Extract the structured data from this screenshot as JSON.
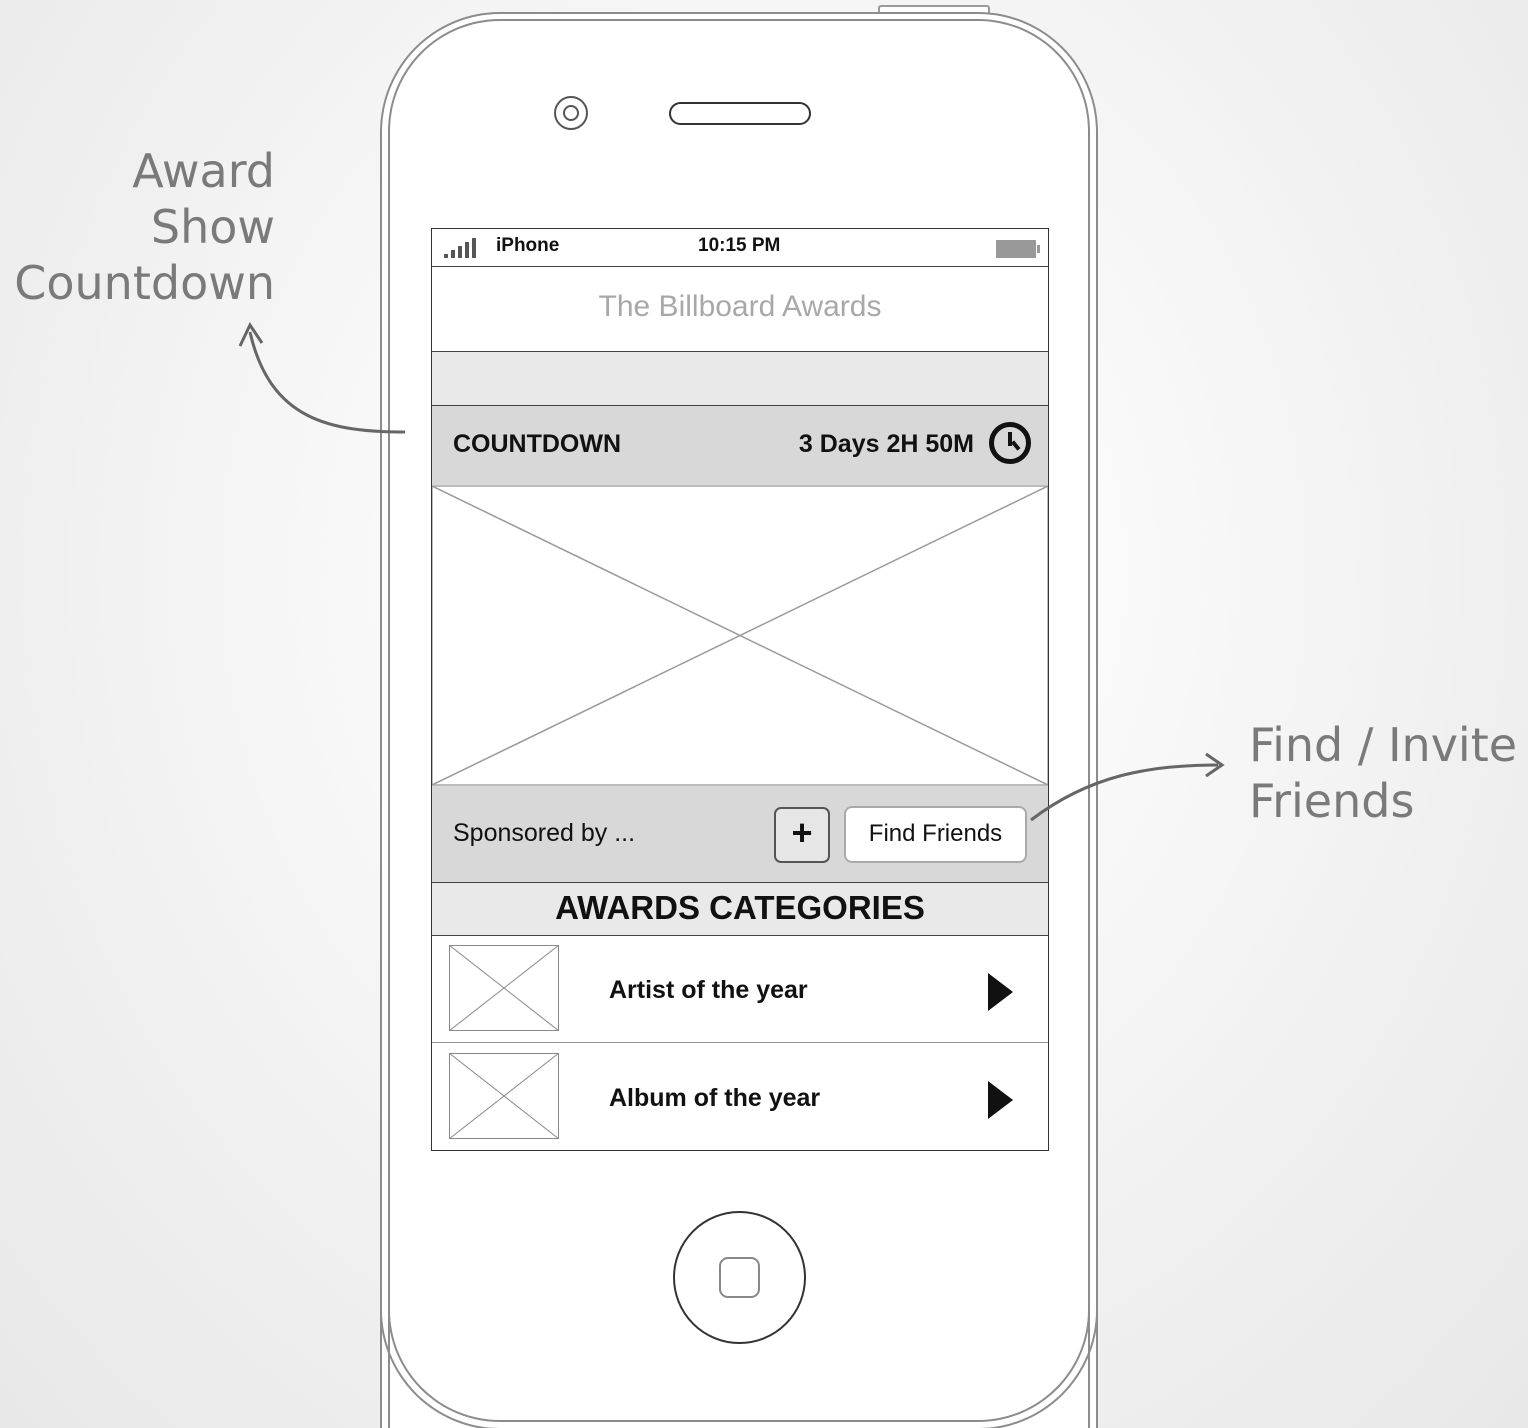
{
  "annotations": {
    "left": [
      "Award",
      "Show",
      "Countdown"
    ],
    "right": [
      "Find / Invite",
      "Friends"
    ]
  },
  "status_bar": {
    "carrier": "iPhone",
    "time": "10:15 PM"
  },
  "nav": {
    "title": "The Billboard Awards"
  },
  "countdown": {
    "label": "COUNTDOWN",
    "time_left": "3 Days 2H 50M",
    "icon": "clock-icon"
  },
  "sponsor": {
    "text": "Sponsored by ...",
    "add_label": "+",
    "find_friends_label": "Find Friends"
  },
  "categories": {
    "header": "AWARDS CATEGORIES",
    "items": [
      {
        "label": "Artist of the year",
        "icon": "chevron-right-icon"
      },
      {
        "label": "Album of the year",
        "icon": "chevron-right-icon"
      }
    ]
  }
}
